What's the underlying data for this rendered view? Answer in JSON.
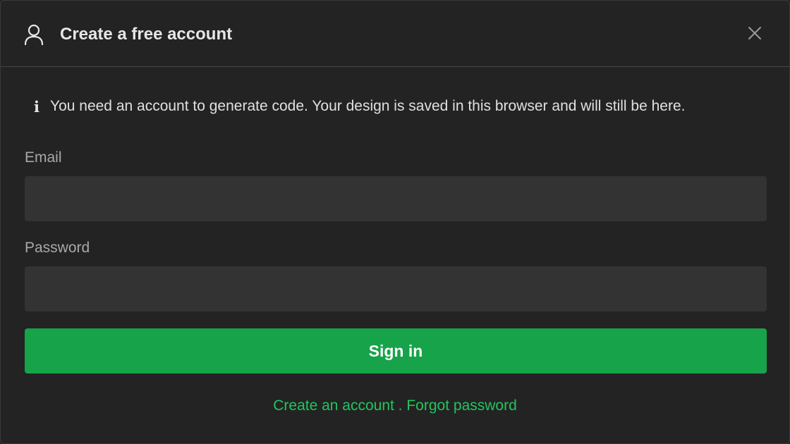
{
  "dialog": {
    "title": "Create a free account",
    "icons": {
      "header": "user-icon",
      "close": "close-icon",
      "info": "info-icon"
    }
  },
  "info": {
    "glyph": "i",
    "message": "You need an account to generate code. Your design is saved in this browser and will still be here."
  },
  "form": {
    "email": {
      "label": "Email",
      "value": "",
      "placeholder": ""
    },
    "password": {
      "label": "Password",
      "value": "",
      "placeholder": ""
    },
    "submit_label": "Sign in"
  },
  "footer": {
    "create_account": "Create an account",
    "separator": " . ",
    "forgot_password": "Forgot password"
  },
  "colors": {
    "background": "#232323",
    "input_background": "#333333",
    "accent": "#17a34a",
    "link": "#22c55e"
  }
}
